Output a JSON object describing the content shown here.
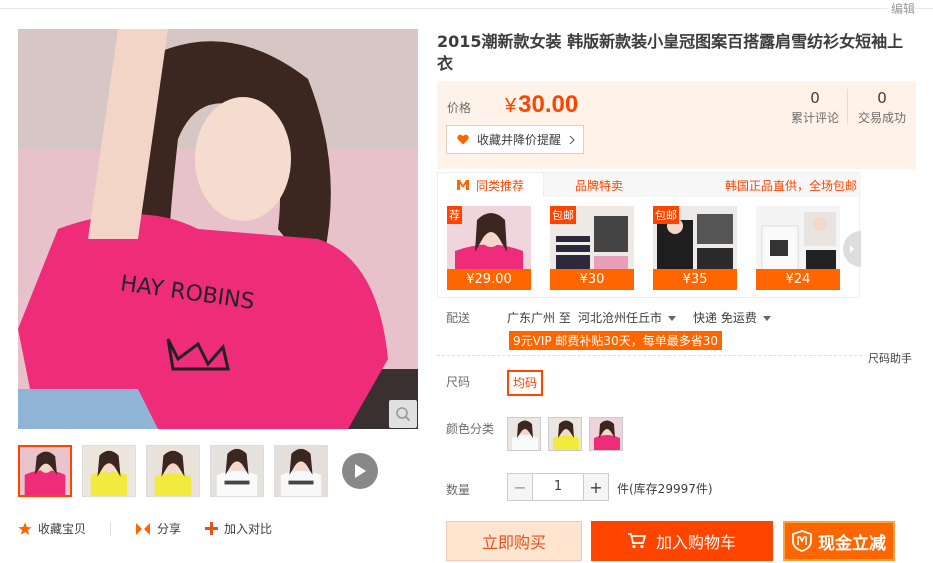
{
  "top": {
    "edit_label": "编辑"
  },
  "gallery": {
    "thumbnail_count": 5,
    "active_thumbnail": 1
  },
  "bottom_actions": {
    "favorite": "收藏宝贝",
    "share": "分享",
    "compare": "加入对比"
  },
  "product": {
    "title": "2015潮新款女装 韩版新款装小皇冠图案百搭露肩雪纺衫女短袖上衣",
    "price_label": "价格",
    "currency": "¥",
    "price": "30.00",
    "reviews_count": "0",
    "reviews_label": "累计评论",
    "trades_count": "0",
    "trades_label": "交易成功",
    "fav_reminder": "收藏并降价提醒"
  },
  "recommend": {
    "tab_similar": "同类推荐",
    "tab_brand": "品牌特卖",
    "note": "韩国正品直供，全场包邮",
    "items": [
      {
        "price": "¥29.00",
        "badge": "荐"
      },
      {
        "price": "¥30",
        "badge": "包邮"
      },
      {
        "price": "¥35",
        "badge": "包邮"
      },
      {
        "price": "¥24",
        "badge": ""
      }
    ]
  },
  "delivery": {
    "label": "配送",
    "from": "广东广州 至",
    "to": "河北沧州任丘市",
    "method": "快递 免运费",
    "vip_note": "9元VIP 邮费补贴30天，每单最多省30"
  },
  "size": {
    "label": "尺码",
    "help": "尺码助手",
    "option": "均码"
  },
  "color": {
    "label": "颜色分类",
    "option_count": 3
  },
  "quantity": {
    "label": "数量",
    "value": "1",
    "minus": "−",
    "plus": "+",
    "stock": "件(库存29997件)"
  },
  "buttons": {
    "buy_now": "立即购买",
    "add_cart": "加入购物车",
    "cash_off": "现金立减"
  },
  "colors": {
    "accent": "#ff4400",
    "price_bg": "#fff2e8",
    "orange": "#ff6600"
  }
}
